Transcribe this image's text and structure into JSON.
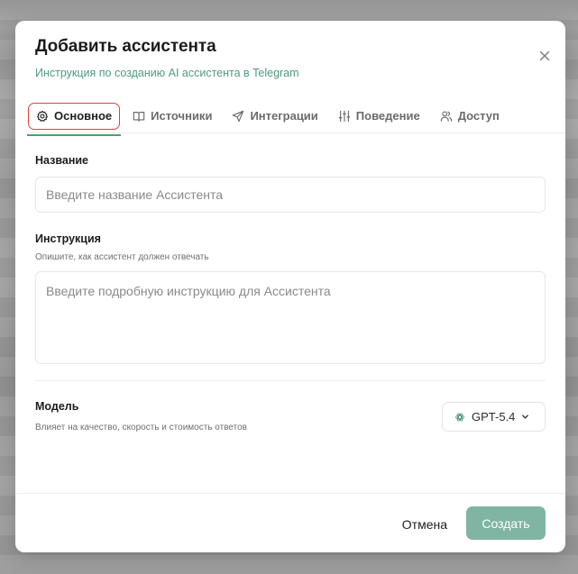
{
  "modal": {
    "title": "Добавить ассистента",
    "subtitle_link": "Инструкция по созданию AI ассистента в Telegram",
    "close_icon": "close-icon"
  },
  "tabs": [
    {
      "label": "Основное",
      "icon": "gear-icon",
      "active": true
    },
    {
      "label": "Источники",
      "icon": "book-icon",
      "active": false
    },
    {
      "label": "Интеграции",
      "icon": "send-icon",
      "active": false
    },
    {
      "label": "Поведение",
      "icon": "sliders-icon",
      "active": false
    },
    {
      "label": "Доступ",
      "icon": "users-icon",
      "active": false
    }
  ],
  "form": {
    "name": {
      "label": "Название",
      "value": "",
      "placeholder": "Введите название Ассистента"
    },
    "instruction": {
      "label": "Инструкция",
      "hint": "Опишите, как ассистент должен отвечать",
      "value": "",
      "placeholder": "Введите подробную инструкцию для Ассистента"
    },
    "model": {
      "label": "Модель",
      "hint": "Влияет на качество, скорость и стоимость ответов",
      "selected": "GPT-5.4",
      "icon": "openai-icon"
    }
  },
  "footer": {
    "cancel_label": "Отмена",
    "create_label": "Создать"
  },
  "colors": {
    "accent": "#4f9a80",
    "primary_button": "#7fb5a2",
    "active_tab_outline": "#d8453e"
  }
}
